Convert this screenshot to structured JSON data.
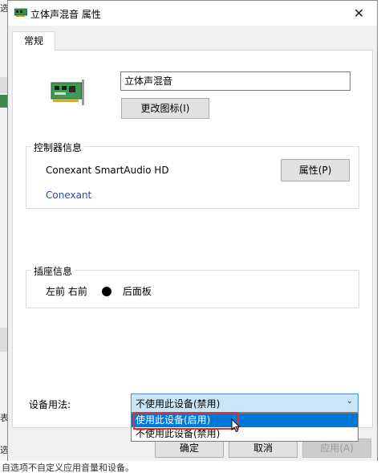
{
  "window": {
    "title": "立体声混音 属性",
    "close_glyph": "✕"
  },
  "tabs": [
    {
      "label": "常规"
    }
  ],
  "general": {
    "device_name": "立体声混音",
    "change_icon_label": "更改图标(I)",
    "controller": {
      "legend": "控制器信息",
      "name": "Conexant SmartAudio HD",
      "vendor_link": "Conexant",
      "properties_label": "属性(P)"
    },
    "jack": {
      "legend": "插座信息",
      "location_text": "左前 右前",
      "panel_text": "后面板"
    },
    "usage": {
      "label": "设备用法:",
      "selected_value": "不使用此设备(禁用)",
      "options": [
        {
          "label": "使用此设备(启用)",
          "highlighted": true
        },
        {
          "label": "不使用此设备(禁用)",
          "highlighted": false
        }
      ]
    }
  },
  "buttons": {
    "ok": "确定",
    "cancel": "取消",
    "apply": "应用(A)"
  },
  "background": {
    "top_fragment": "选",
    "left_fragment_1": "表",
    "left_fragment_2": "选",
    "bottom_fragment": "自选项不自定义应用音量和设备。"
  },
  "colors": {
    "selection_blue": "#0078d7",
    "select_bg": "#cde6f7",
    "highlight_red": "#d9353b",
    "link_blue": "#2b4f8c"
  },
  "icons": {
    "title": "sound-card-icon",
    "device": "sound-card-icon",
    "close": "close-icon",
    "dropdown": "chevron-down-icon",
    "cursor": "mouse-cursor-icon"
  }
}
